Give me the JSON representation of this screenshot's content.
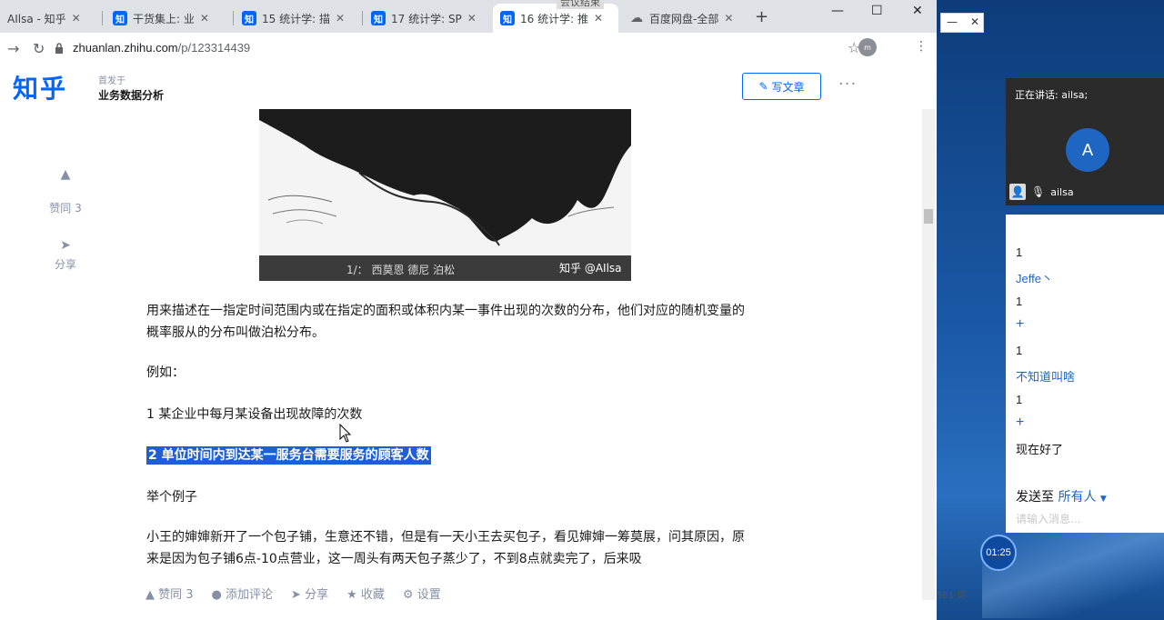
{
  "tabs": [
    {
      "label": "AIlsa - 知乎",
      "favicon": ""
    },
    {
      "label": "干货集上: 业",
      "favicon": "知"
    },
    {
      "label": "15 统计学: 描",
      "favicon": "知"
    },
    {
      "label": "17 统计学: SP",
      "favicon": "知"
    },
    {
      "label": "16 统计学: 推",
      "favicon": "知"
    },
    {
      "label": "百度网盘-全部",
      "favicon": "☁"
    }
  ],
  "meeting_tag": "会议结束",
  "url": {
    "host": "zhuanlan.zhihu.com",
    "path": "/p/123314439"
  },
  "profile_initials": "m",
  "zhihu": {
    "logo": "知乎",
    "kicker": "首发于",
    "column_name": "业务数据分析",
    "write_button": "写文章",
    "more": "···"
  },
  "side_actions": {
    "like_label": "赞同 3",
    "share_label": "分享"
  },
  "image": {
    "caption_left": "1/：  西莫恩 德尼 泊松",
    "caption_right": "知乎 @AIlsa"
  },
  "article": {
    "para1": "用来描述在一指定时间范围内或在指定的面积或体积内某一事件出现的次数的分布，他们对应的随机变量的概率服从的分布叫做泊松分布。",
    "example_heading": "例如：",
    "item1": "1 某企业中每月某设备出现故障的次数",
    "item2": "2 单位时间内到达某一服务台需要服务的顾客人数",
    "sub_heading": "举个例子",
    "para2": "小王的婶婶新开了一个包子铺，生意还不错，但是有一天小王去买包子，看见婶婶一筹莫展，问其原因，原来是因为包子铺6点-10点营业，这一周头有两天包子蒸少了，不到8点就卖完了，后来吸"
  },
  "bottom_bar": {
    "like": "赞同 3",
    "comment": "添加评论",
    "share": "分享",
    "collect": "收藏",
    "settings": "设置"
  },
  "word_count": "581 词",
  "meeting": {
    "speaking": "正在讲话: ailsa;",
    "avatar_letter": "A",
    "user_name": "ailsa",
    "chat": [
      {
        "text": "1",
        "style": "num"
      },
      {
        "text": "Jeffe丶",
        "style": "blue"
      },
      {
        "text": "1",
        "style": "num"
      },
      {
        "text": "+",
        "style": "blue"
      },
      {
        "text": "1",
        "style": "num"
      },
      {
        "text": "不知道叫啥",
        "style": "blue"
      },
      {
        "text": "1",
        "style": "num"
      },
      {
        "text": "+",
        "style": "blue"
      },
      {
        "text": "现在好了",
        "style": "dark"
      }
    ],
    "send_to_label": "发送至",
    "send_to_target": "所有人",
    "input_placeholder": "请输入消息...",
    "timer": "01:25"
  },
  "colors": {
    "zhihu_blue": "#0066ff",
    "highlight": "#1f5fd6"
  }
}
